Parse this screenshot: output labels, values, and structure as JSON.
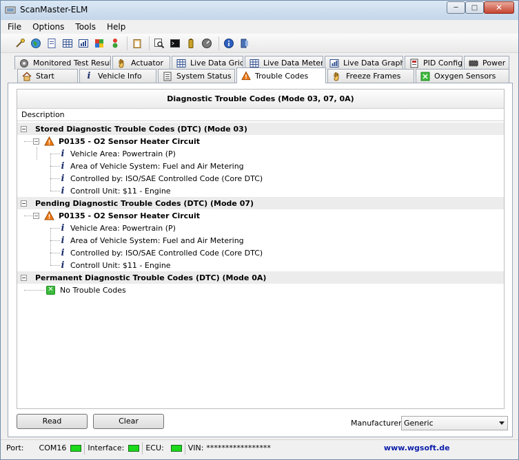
{
  "window": {
    "title": "ScanMaster-ELM"
  },
  "menu": [
    "File",
    "Options",
    "Tools",
    "Help"
  ],
  "toolbar_icons": [
    "connect-icon",
    "globe-icon",
    "document-icon",
    "grid-icon",
    "chart-icon",
    "flag-icon",
    "traffic-light-icon",
    "clipboard-icon",
    "search-icon",
    "terminal-icon",
    "battery-icon",
    "gauge-icon",
    "info-icon",
    "exit-icon"
  ],
  "tabs_row1": [
    {
      "label": "Monitored Test Results",
      "icon": "gear-icon"
    },
    {
      "label": "Actuator",
      "icon": "hand-icon"
    },
    {
      "label": "Live Data Grid",
      "icon": "grid-icon"
    },
    {
      "label": "Live Data Meter",
      "icon": "meter-icon"
    },
    {
      "label": "Live Data Graph",
      "icon": "graph-icon"
    },
    {
      "label": "PID Config",
      "icon": "pid-icon"
    },
    {
      "label": "Power",
      "icon": "power-icon"
    }
  ],
  "tabs_row2": [
    {
      "label": "Start",
      "icon": "home-icon"
    },
    {
      "label": "Vehicle Info",
      "icon": "info-icon"
    },
    {
      "label": "System Status",
      "icon": "status-icon"
    },
    {
      "label": "Trouble Codes",
      "icon": "warning-icon"
    },
    {
      "label": "Freeze Frames",
      "icon": "hand-icon"
    },
    {
      "label": "Oxygen Sensors",
      "icon": "sensor-icon"
    }
  ],
  "active_tab": "Trouble Codes",
  "list": {
    "title": "Diagnostic Trouble Codes (Mode 03, 07, 0A)",
    "column_header": "Description",
    "groups": [
      {
        "label": "Stored Diagnostic Trouble Codes (DTC) (Mode 03)",
        "code": "P0135 - O2 Sensor Heater Circuit",
        "details": [
          "Vehicle Area: Powertrain (P)",
          "Area of Vehicle System: Fuel and Air Metering",
          "Controlled by: ISO/SAE Controlled Code (Core DTC)",
          "Controll Unit: $11 - Engine"
        ]
      },
      {
        "label": "Pending Diagnostic Trouble Codes (DTC) (Mode 07)",
        "code": "P0135 - O2 Sensor Heater Circuit",
        "details": [
          "Vehicle Area: Powertrain (P)",
          "Area of Vehicle System: Fuel and Air Metering",
          "Controlled by: ISO/SAE Controlled Code (Core DTC)",
          "Controll Unit: $11 - Engine"
        ]
      },
      {
        "label": "Permanent Diagnostic Trouble Codes (DTC) (Mode 0A)",
        "none_text": "No Trouble Codes"
      }
    ]
  },
  "buttons": {
    "read": "Read",
    "clear": "Clear"
  },
  "manufacturer": {
    "label": "Manufacturer",
    "value": "Generic"
  },
  "status": {
    "port_label": "Port:",
    "port_value": "COM16",
    "interface_label": "Interface:",
    "ecu_label": "ECU:",
    "vin_label": "VIN:",
    "vin_value": "*****************",
    "website": "www.wgsoft.de",
    "led_color": "#1cd91c"
  },
  "colors": {
    "accent": "#1d2f6b",
    "warning": "#f07a12",
    "ok": "#3cba3c",
    "link": "#0b1eaa"
  }
}
